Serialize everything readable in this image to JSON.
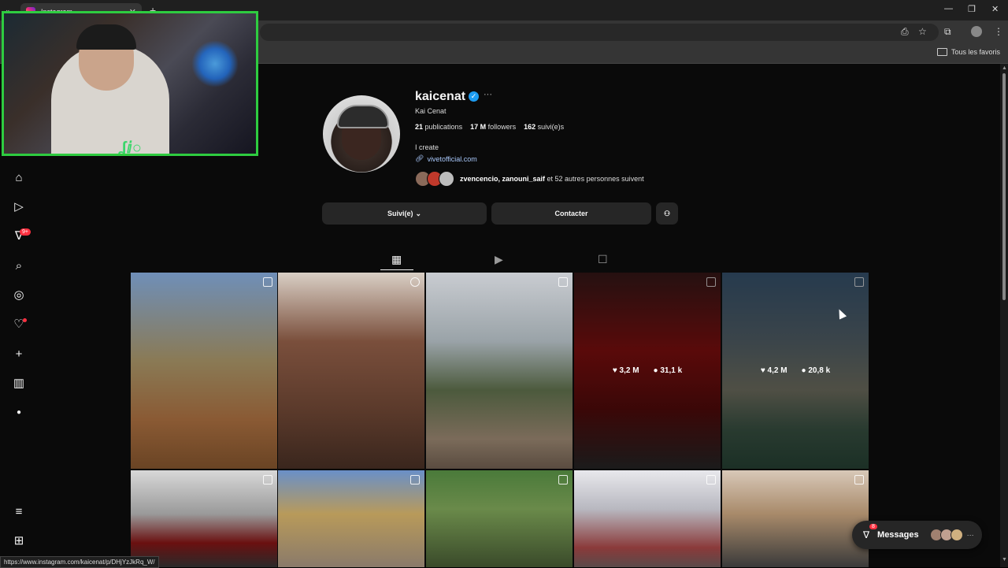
{
  "browser": {
    "tab_title": "Instagram",
    "bookmark_folder": "Tous les favoris",
    "status_url": "https://www.instagram.com/kaicenat/p/DHjYzJkRq_W/"
  },
  "nav": {
    "notifications_badge": "9+"
  },
  "profile": {
    "username": "kaicenat",
    "full_name": "Kai Cenat",
    "posts_count": "21",
    "posts_label": "publications",
    "followers_count": "17 M",
    "followers_label": "followers",
    "following_count": "162",
    "following_label": "suivi(e)s",
    "bio": "I create",
    "link": "vivetofficial.com",
    "followed_by_names": "zvencencio, zanouni_saif",
    "followed_by_rest": " et 52 autres personnes suivent"
  },
  "actions": {
    "following_button": "Suivi(e)",
    "contact_button": "Contacter"
  },
  "posts": [
    {
      "likes": "",
      "comments": ""
    },
    {
      "likes": "",
      "comments": ""
    },
    {
      "likes": "",
      "comments": ""
    },
    {
      "likes": "3,2 M",
      "comments": "31,1 k"
    },
    {
      "likes": "4,2 M",
      "comments": "20,8 k"
    }
  ],
  "messages": {
    "label": "Messages",
    "badge": "8"
  },
  "colors": {
    "accent": "#1d9bf0",
    "badge": "#ff3040",
    "link": "#a8c7fa",
    "webcam_border": "#2ecc40"
  }
}
